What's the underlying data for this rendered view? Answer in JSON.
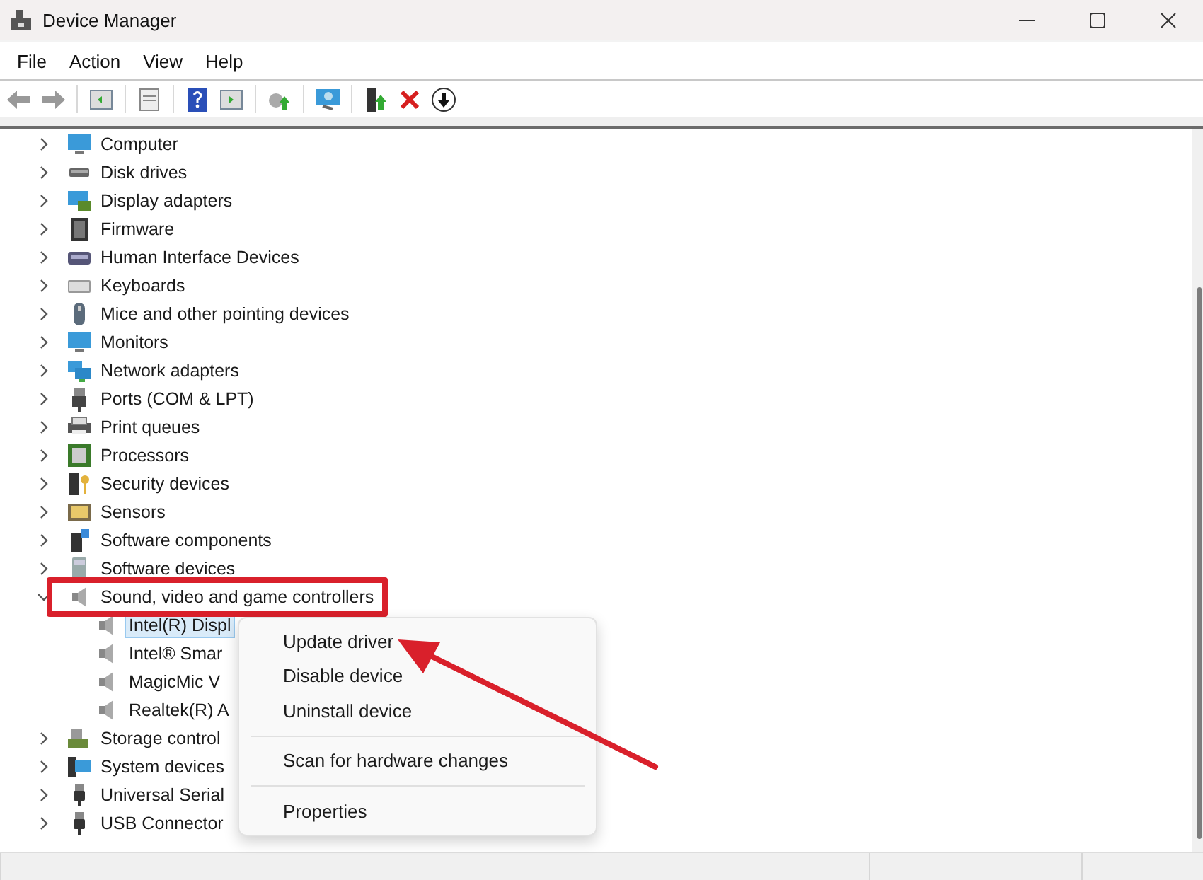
{
  "window": {
    "title": "Device Manager"
  },
  "menu": [
    "File",
    "Action",
    "View",
    "Help"
  ],
  "tree": [
    {
      "label": "Computer",
      "expanded": false
    },
    {
      "label": "Disk drives",
      "expanded": false
    },
    {
      "label": "Display adapters",
      "expanded": false
    },
    {
      "label": "Firmware",
      "expanded": false
    },
    {
      "label": "Human Interface Devices",
      "expanded": false
    },
    {
      "label": "Keyboards",
      "expanded": false
    },
    {
      "label": "Mice and other pointing devices",
      "expanded": false
    },
    {
      "label": "Monitors",
      "expanded": false
    },
    {
      "label": "Network adapters",
      "expanded": false
    },
    {
      "label": "Ports (COM & LPT)",
      "expanded": false
    },
    {
      "label": "Print queues",
      "expanded": false
    },
    {
      "label": "Processors",
      "expanded": false
    },
    {
      "label": "Security devices",
      "expanded": false
    },
    {
      "label": "Sensors",
      "expanded": false
    },
    {
      "label": "Software components",
      "expanded": false
    },
    {
      "label": "Software devices",
      "expanded": false
    },
    {
      "label": "Sound, video and game controllers",
      "expanded": true,
      "highlighted": true,
      "children": [
        {
          "label": "Intel(R) Displ",
          "selected": true
        },
        {
          "label": "Intel® Smar",
          "selected": false
        },
        {
          "label": "MagicMic V",
          "selected": false
        },
        {
          "label": "Realtek(R) A",
          "selected": false
        }
      ]
    },
    {
      "label": "Storage control",
      "expanded": false
    },
    {
      "label": "System devices",
      "expanded": false
    },
    {
      "label": "Universal Serial",
      "expanded": false
    },
    {
      "label": "USB Connector",
      "expanded": false
    }
  ],
  "context_menu": [
    {
      "kind": "item",
      "label": "Update driver"
    },
    {
      "kind": "item",
      "label": "Disable device"
    },
    {
      "kind": "item",
      "label": "Uninstall device"
    },
    {
      "kind": "separator"
    },
    {
      "kind": "item",
      "label": "Scan for hardware changes"
    },
    {
      "kind": "separator"
    },
    {
      "kind": "item",
      "label": "Properties"
    }
  ]
}
